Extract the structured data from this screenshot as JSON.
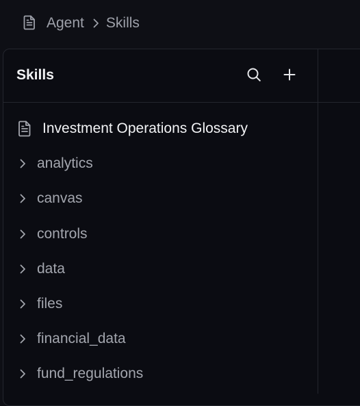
{
  "breadcrumb": {
    "icon": "document-icon",
    "items": [
      "Agent",
      "Skills"
    ]
  },
  "panel": {
    "title": "Skills",
    "actions": [
      "search-icon",
      "plus-icon"
    ]
  },
  "tree": {
    "document": "Investment Operations Glossary",
    "folders": [
      "analytics",
      "canvas",
      "controls",
      "data",
      "files",
      "financial_data",
      "fund_regulations"
    ]
  },
  "colors": {
    "background": "#0e0f15",
    "panel": "#0b0c12",
    "border": "#24262e",
    "text_primary": "#f2f3f5",
    "text_muted": "#a3a6ae"
  }
}
